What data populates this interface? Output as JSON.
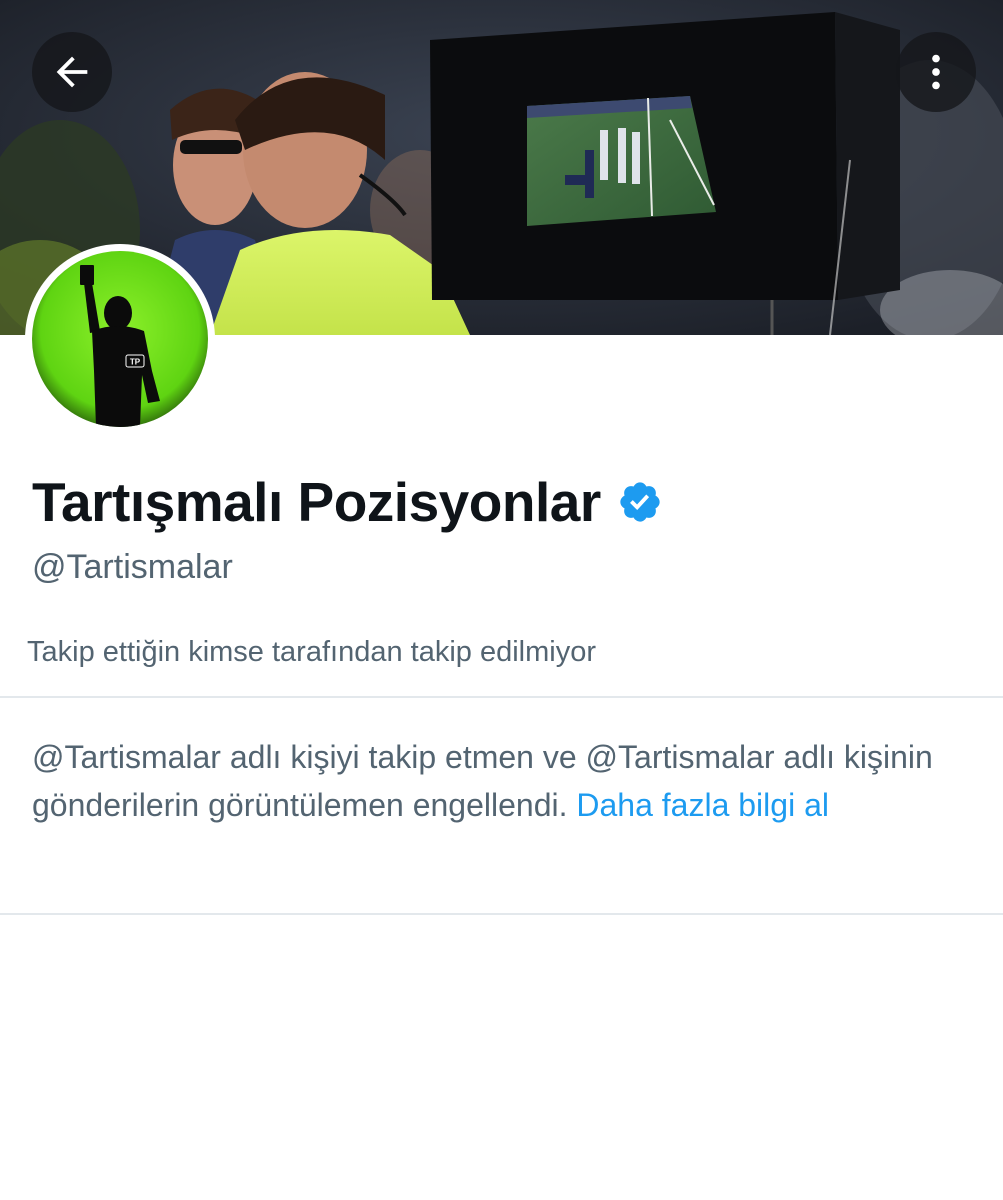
{
  "header": {
    "back_icon": "arrow-left-icon",
    "more_icon": "more-vertical-icon"
  },
  "profile": {
    "display_name": "Tartışmalı Pozisyonlar",
    "verified_icon": "verified-badge-icon",
    "handle": "@Tartismalar",
    "avatar_monogram": "TP",
    "follow_context": "Takip ettiğin kimse tarafından takip edilmiyor"
  },
  "notice": {
    "text": "@Tartismalar adlı kişiyi takip etmen ve @Tartismalar adlı kişinin gönderilerin görüntülemen engellendi.",
    "link_label": "Daha fazla bilgi al"
  },
  "colors": {
    "text_primary": "#0f1419",
    "text_secondary": "#536471",
    "accent": "#1d9bf0",
    "divider": "#e3e8ec",
    "avatar_green": "#6ee01a"
  }
}
